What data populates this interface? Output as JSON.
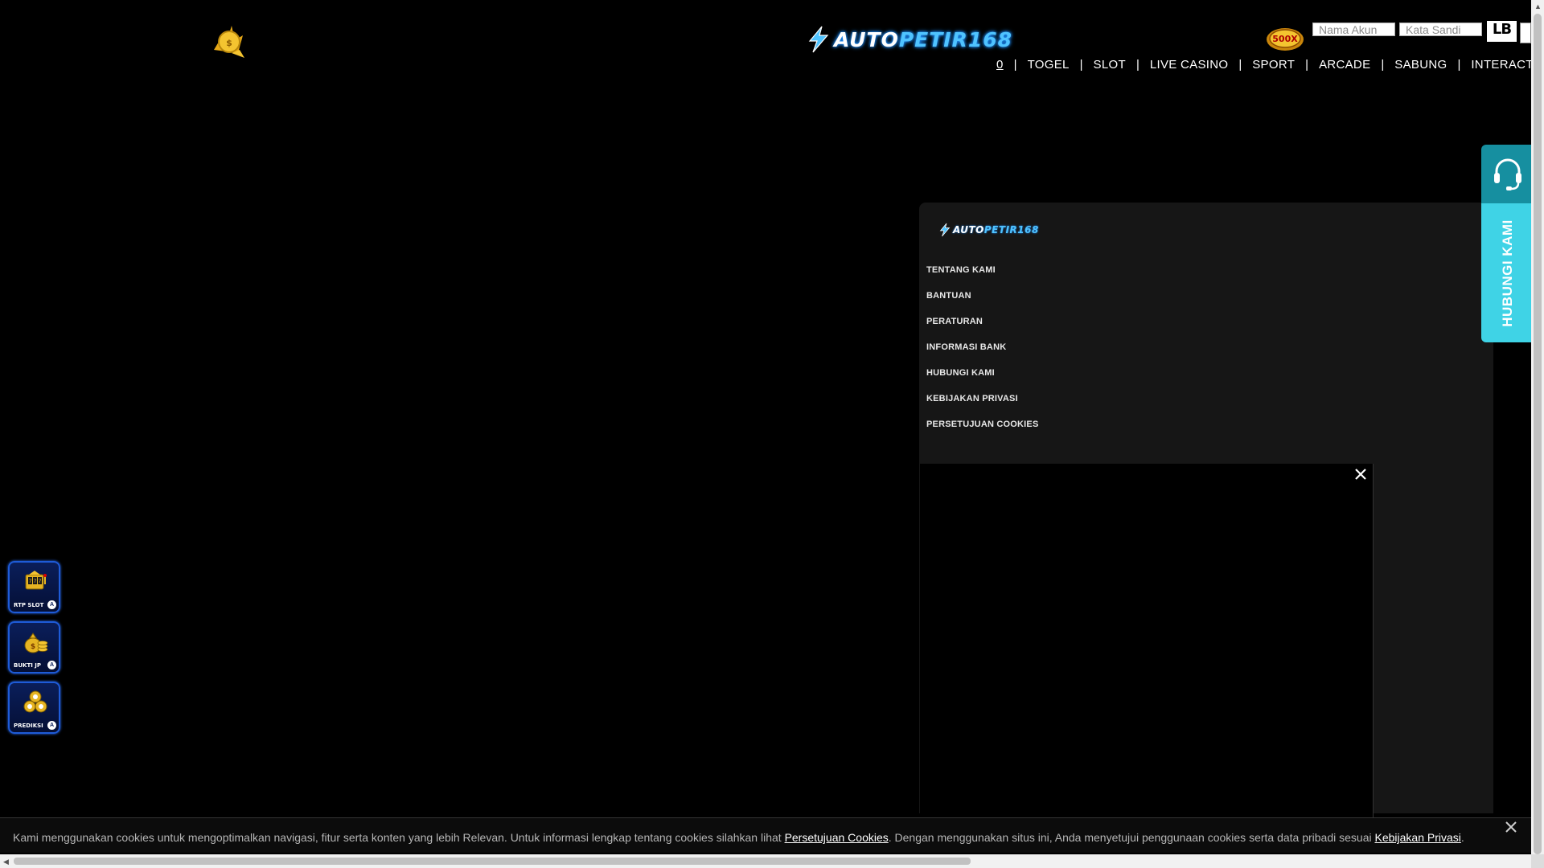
{
  "header": {
    "brand_prefix": "AUTO",
    "brand_highlight": "PETIR168",
    "login": {
      "username_placeholder": "Nama Akun",
      "password_placeholder": "Kata Sandi",
      "lb_label": "LB"
    },
    "nav": [
      {
        "label": "0"
      },
      {
        "label": "TOGEL"
      },
      {
        "label": "SLOT"
      },
      {
        "label": "LIVE CASINO"
      },
      {
        "label": "SPORT"
      },
      {
        "label": "ARCADE"
      },
      {
        "label": "SABUNG"
      },
      {
        "label": "INTERACTIVE"
      }
    ]
  },
  "footer_menu": [
    "TENTANG KAMI",
    "BANTUAN",
    "PERATURAN",
    "INFORMASI BANK",
    "HUBUNGI KAMI",
    "KEBIJAKAN PRIVASI",
    "PERSETUJUAN COOKIES"
  ],
  "contact_tab": {
    "label": "HUBUNGI KAMI",
    "icon": "headset-icon",
    "colors": {
      "top": "#168fa0",
      "bottom": "#3fd3e6"
    }
  },
  "widgets": [
    {
      "label": "RTP SLOT",
      "icon": "slot-machine-icon",
      "badge": "A"
    },
    {
      "label": "BUKTI JP",
      "icon": "money-bag-icon",
      "badge": "A"
    },
    {
      "label": "PREDIKSI",
      "icon": "lottery-balls-icon",
      "badge": "A"
    }
  ],
  "cookie_bar": {
    "text_1": "Kami menggunakan cookies untuk mengoptimalkan navigasi, fitur serta konten yang lebih Relevan. Untuk informasi lengkap tentang cookies silahkan lihat ",
    "link_1": "Persetujuan Cookies",
    "text_2": ". Dengan menggunakan situs ini, Anda menyetujui penggunaan cookies serta data pribadi sesuai ",
    "link_2": "Kebijakan Privasi",
    "text_3": "."
  },
  "colors": {
    "background": "#000000",
    "panel": "#161616",
    "accent_blue": "#1e5bd8",
    "gold": "#e6b422"
  }
}
